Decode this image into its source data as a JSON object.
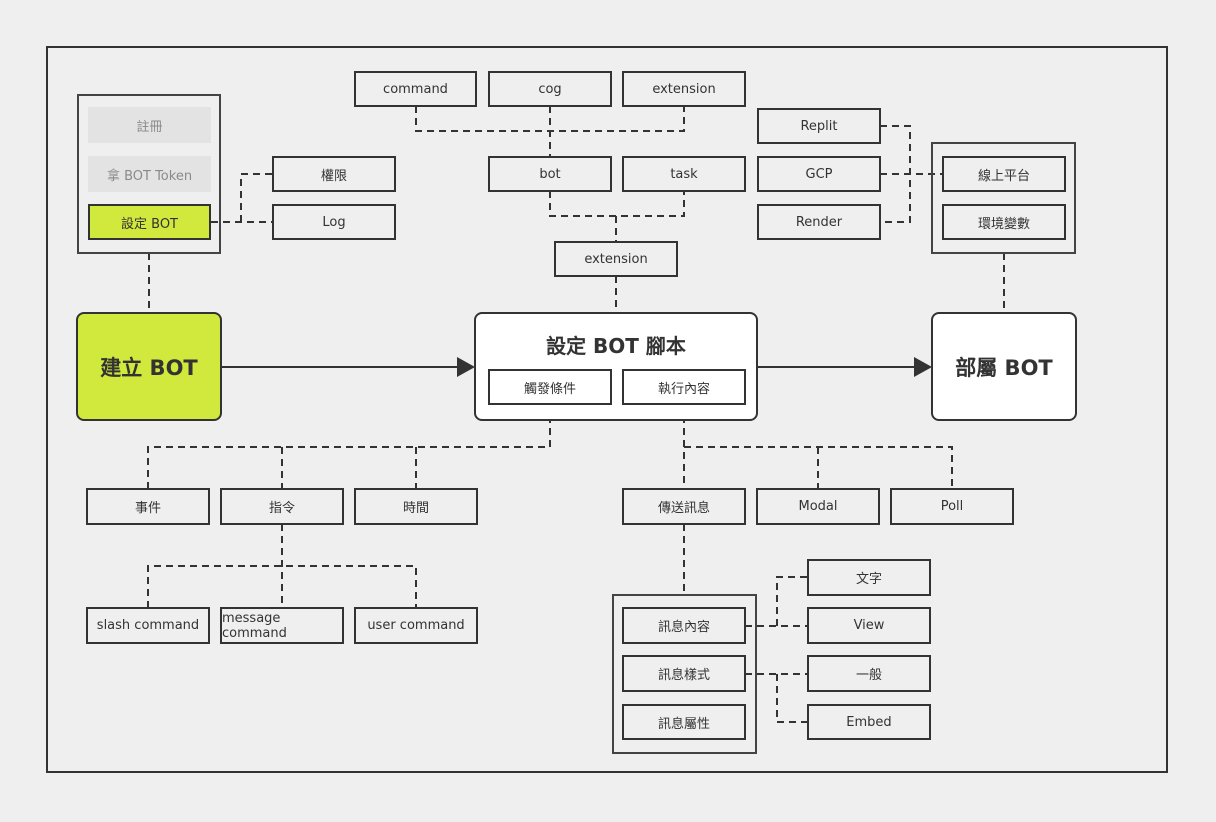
{
  "colors": {
    "accent": "#d1e83c",
    "line": "#333333"
  },
  "create_group": {
    "items": [
      "註冊",
      "拿 BOT Token",
      "設定 BOT"
    ]
  },
  "settings": [
    "權限",
    "Log"
  ],
  "code_top": [
    "command",
    "cog",
    "extension"
  ],
  "code_mid": [
    "bot",
    "task"
  ],
  "code_ext": "extension",
  "hosting": [
    "Replit",
    "GCP",
    "Render"
  ],
  "deploy_group": [
    "線上平台",
    "環境變數"
  ],
  "main": {
    "create": "建立 BOT",
    "script": "設定 BOT 腳本",
    "trigger": "觸發條件",
    "execute": "執行內容",
    "deploy": "部屬 BOT"
  },
  "triggers": [
    "事件",
    "指令",
    "時間"
  ],
  "commands": [
    "slash command",
    "message command",
    "user command"
  ],
  "actions": [
    "傳送訊息",
    "Modal",
    "Poll"
  ],
  "message_group": [
    "訊息內容",
    "訊息樣式",
    "訊息屬性"
  ],
  "message_options": [
    "文字",
    "View",
    "一般",
    "Embed"
  ]
}
